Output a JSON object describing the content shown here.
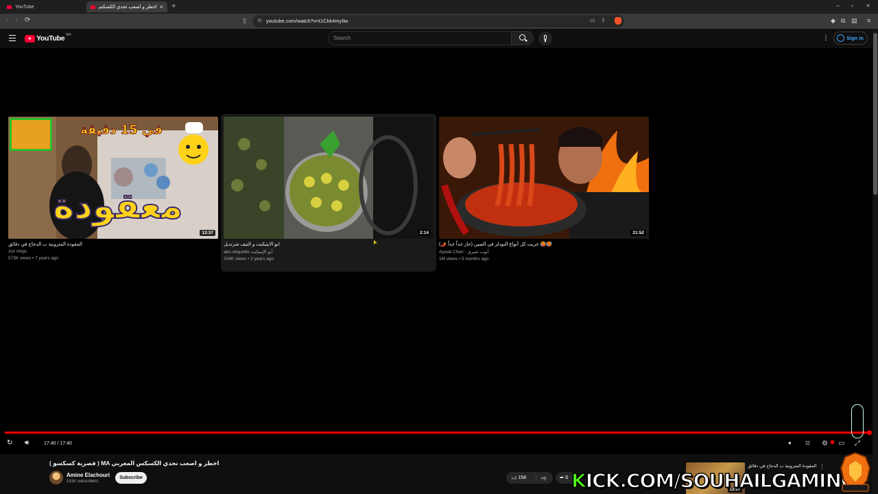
{
  "browser": {
    "tabs": [
      {
        "label": "YouTube",
        "active": false
      },
      {
        "label": "اخطر و اصعب تحدي الكسكس الم",
        "active": true
      }
    ],
    "url": "youtube.com/watch?v=t1Ckk4myIlw"
  },
  "masthead": {
    "logo_text": "YouTube",
    "country_code": "MA",
    "search_placeholder": "Search",
    "sign_in_label": "Sign in"
  },
  "end_screen": [
    {
      "title": "المقودة المترونية ب الدجاج في دقائق",
      "channel": "zoz vlogs",
      "views": "573K views",
      "age": "7 years ago",
      "duration": "13:37",
      "thumb_overlay_title": "معقودة",
      "thumb_overlay_sub": "في 15 دقيقة"
    },
    {
      "title": "ابو الايتيكيت و التيف شرتديل",
      "channel": "abo.etiquette أبو الإيتيكيت",
      "views": "204K views",
      "age": "2 years ago",
      "duration": "2:14"
    },
    {
      "title": "جربت كل أنواع النودلز في الصين (حار جداً جداً 🌶️) 🥵🥵",
      "channel": "Ayoub Cheri - أيوب شيري",
      "views": "1M views",
      "age": "5 months ago",
      "duration": "21:52"
    }
  ],
  "player": {
    "time_display": "17:40 / 17:40",
    "progress": 1.0
  },
  "below": {
    "title": "( قصرية كسكسو ) MA اخطر و اصعب تحدي الكسكس المغربي",
    "channel_name": "Amine Elachouri",
    "subscribers": "141K subscribers",
    "subscribe_label": "Subscribe",
    "likes": "158",
    "share_label": "S",
    "next_video_title": "المقودة المترونية ب الدجاج في دقائق",
    "next_video_duration": "13:37"
  },
  "overlay": {
    "watermark_k": "K",
    "watermark_rest": "ICK.COM/SOUHAILGAMING"
  },
  "colors": {
    "accent_red": "#ff0000",
    "link_blue": "#3ea6ff",
    "kick_green": "#53fc18"
  }
}
